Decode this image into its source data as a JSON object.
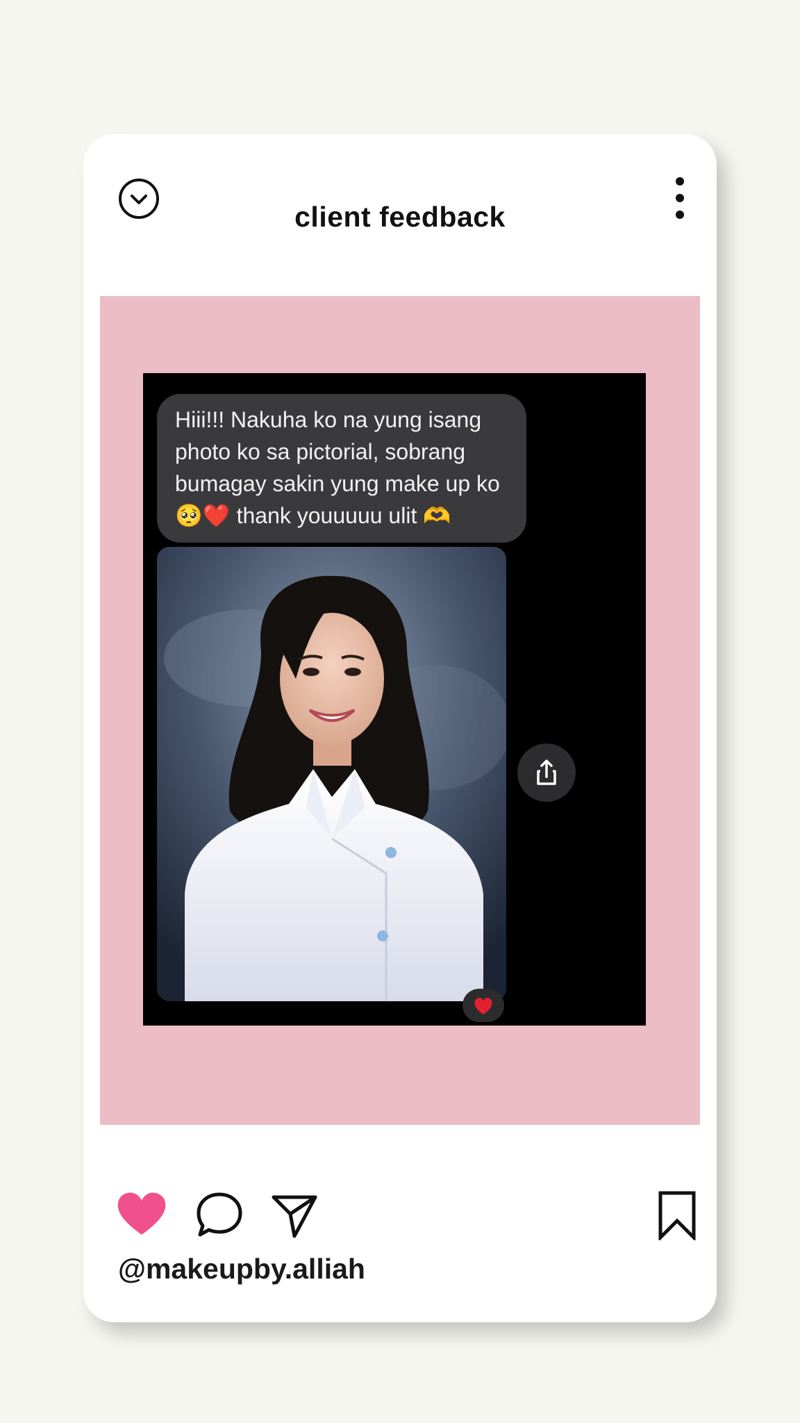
{
  "post": {
    "title": "client feedback",
    "username": "@makeupby.alliah",
    "liked": true
  },
  "message": {
    "text": "Hiii!!! Nakuha ko na yung isang\nphoto ko sa pictorial, sobrang\nbumagay sakin yung make up ko\n🥺❤️ thank youuuuu ulit 🫶",
    "reaction": "❤️"
  },
  "icons": {
    "collapse": "chevron-down-circle-icon",
    "more": "more-vertical-icon",
    "share": "share-icon",
    "like": "heart-icon",
    "comment": "comment-icon",
    "send": "send-icon",
    "save": "bookmark-icon"
  },
  "colors": {
    "page_background": "#f5f6f0",
    "panel_pink": "#ecbcc7",
    "like_pink": "#f0508c",
    "bubble_gray": "#3a3a3c"
  }
}
